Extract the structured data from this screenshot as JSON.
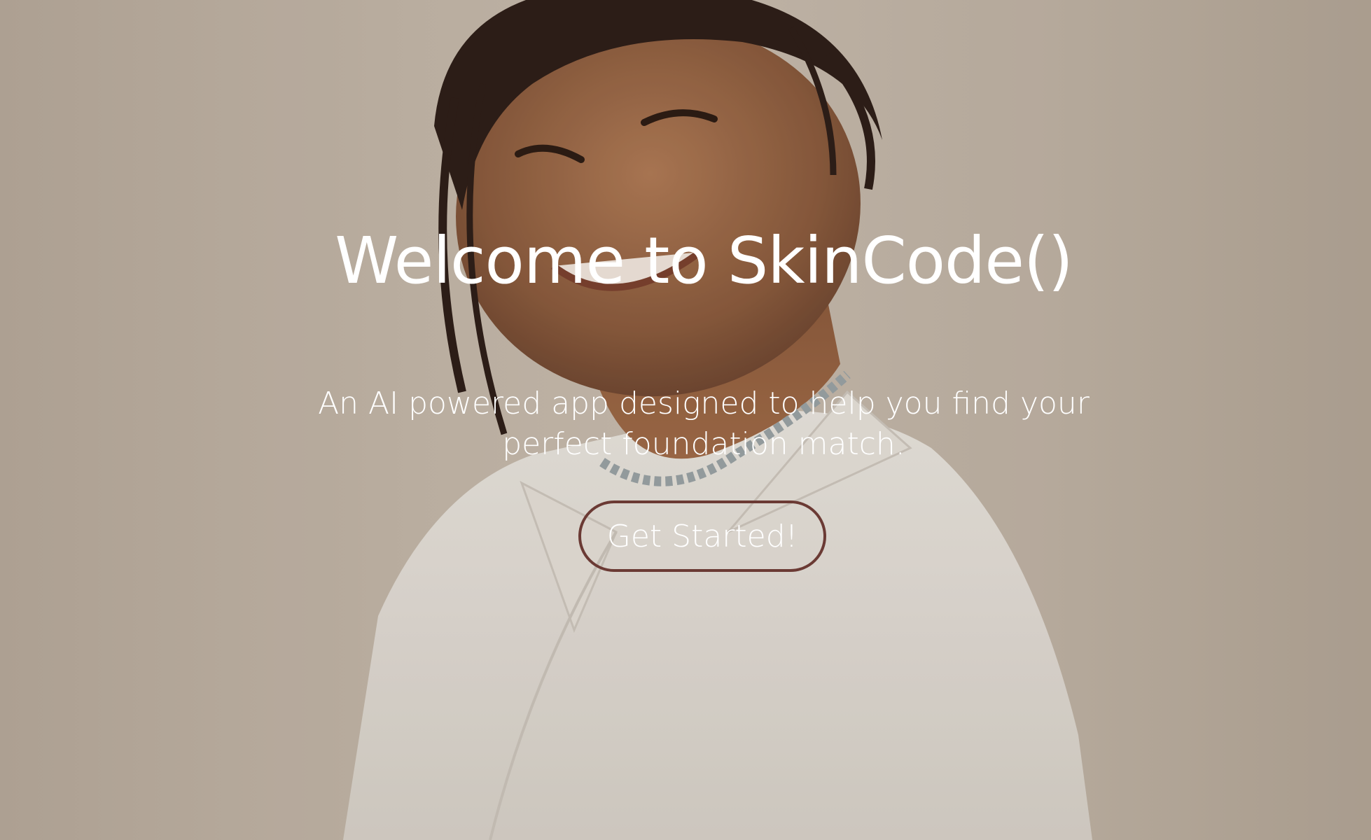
{
  "hero": {
    "title": "Welcome to SkinCode()",
    "subtitle": "An AI powered app designed to help you find your perfect foundation match.",
    "cta_label": "Get Started!"
  },
  "colors": {
    "text": "#ffffff",
    "button_border": "#6b3a34",
    "background": "#c4b8aa"
  }
}
